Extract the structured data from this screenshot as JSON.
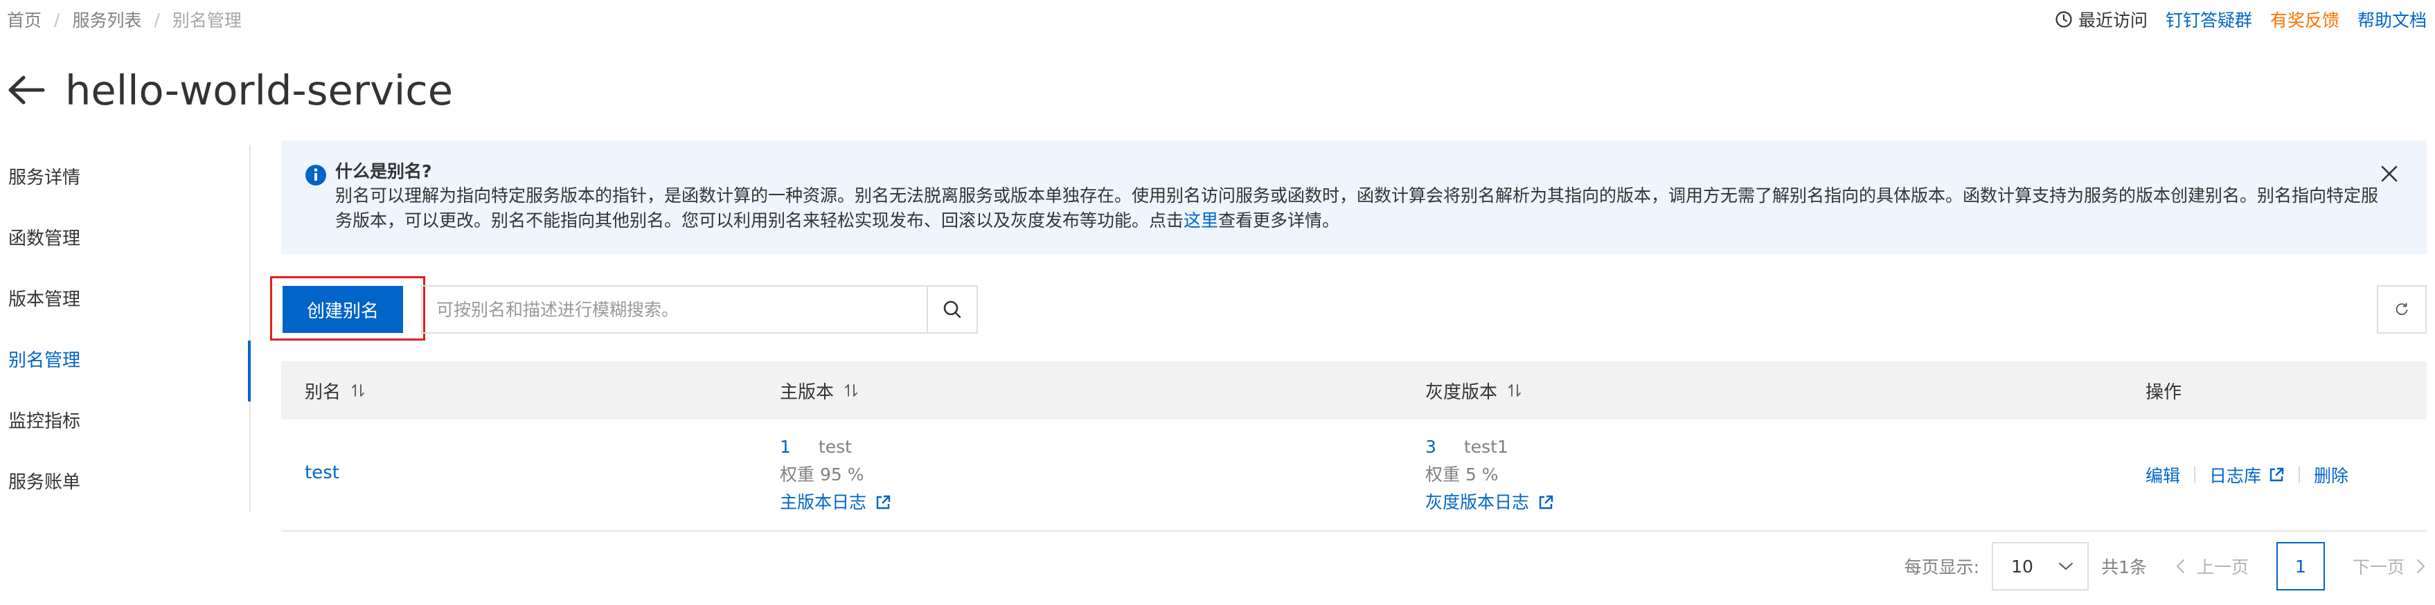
{
  "breadcrumb": [
    "首页",
    "服务列表",
    "别名管理"
  ],
  "topnav": {
    "recent": "最近访问",
    "dingtalk": "钉钉答疑群",
    "feedback": "有奖反馈",
    "docs": "帮助文档"
  },
  "page_title": "hello-world-service",
  "sidebar": {
    "items": [
      {
        "label": "服务详情"
      },
      {
        "label": "函数管理"
      },
      {
        "label": "版本管理"
      },
      {
        "label": "别名管理"
      },
      {
        "label": "监控指标"
      },
      {
        "label": "服务账单"
      }
    ],
    "active_index": 3
  },
  "alert": {
    "title": "什么是别名?",
    "body_part1": "别名可以理解为指向特定服务版本的指针，是函数计算的一种资源。别名无法脱离服务或版本单独存在。使用别名访问服务或函数时，函数计算会将别名解析为其指向的版本，调用方无需了解别名指向的具体版本。函数计算支持为服务的版本创建别名。别名指向特定服务版本，可以更改。别名不能指向其他别名。您可以利用别名来轻松实现发布、回滚以及灰度发布等功能。点击",
    "link": "这里",
    "body_part2": "查看更多详情。"
  },
  "toolbar": {
    "create_label": "创建别名",
    "search_placeholder": "可按别名和描述进行模糊搜索。"
  },
  "table": {
    "headers": {
      "name": "别名",
      "main_version": "主版本",
      "gray_version": "灰度版本",
      "actions": "操作"
    },
    "rows": [
      {
        "name": "test",
        "main": {
          "num": "1",
          "vname": "test",
          "weight": "权重 95 %",
          "log": "主版本日志"
        },
        "gray": {
          "num": "3",
          "vname": "test1",
          "weight": "权重 5 %",
          "log": "灰度版本日志"
        },
        "ops": {
          "edit": "编辑",
          "logstore": "日志库",
          "delete": "删除"
        }
      }
    ]
  },
  "pagination": {
    "per_page_label": "每页显示:",
    "page_size": "10",
    "total": "共1条",
    "prev": "上一页",
    "current": "1",
    "next": "下一页"
  },
  "colors": {
    "primary": "#0064c8",
    "orange": "#ff7000",
    "highlight_border": "#e02020"
  }
}
